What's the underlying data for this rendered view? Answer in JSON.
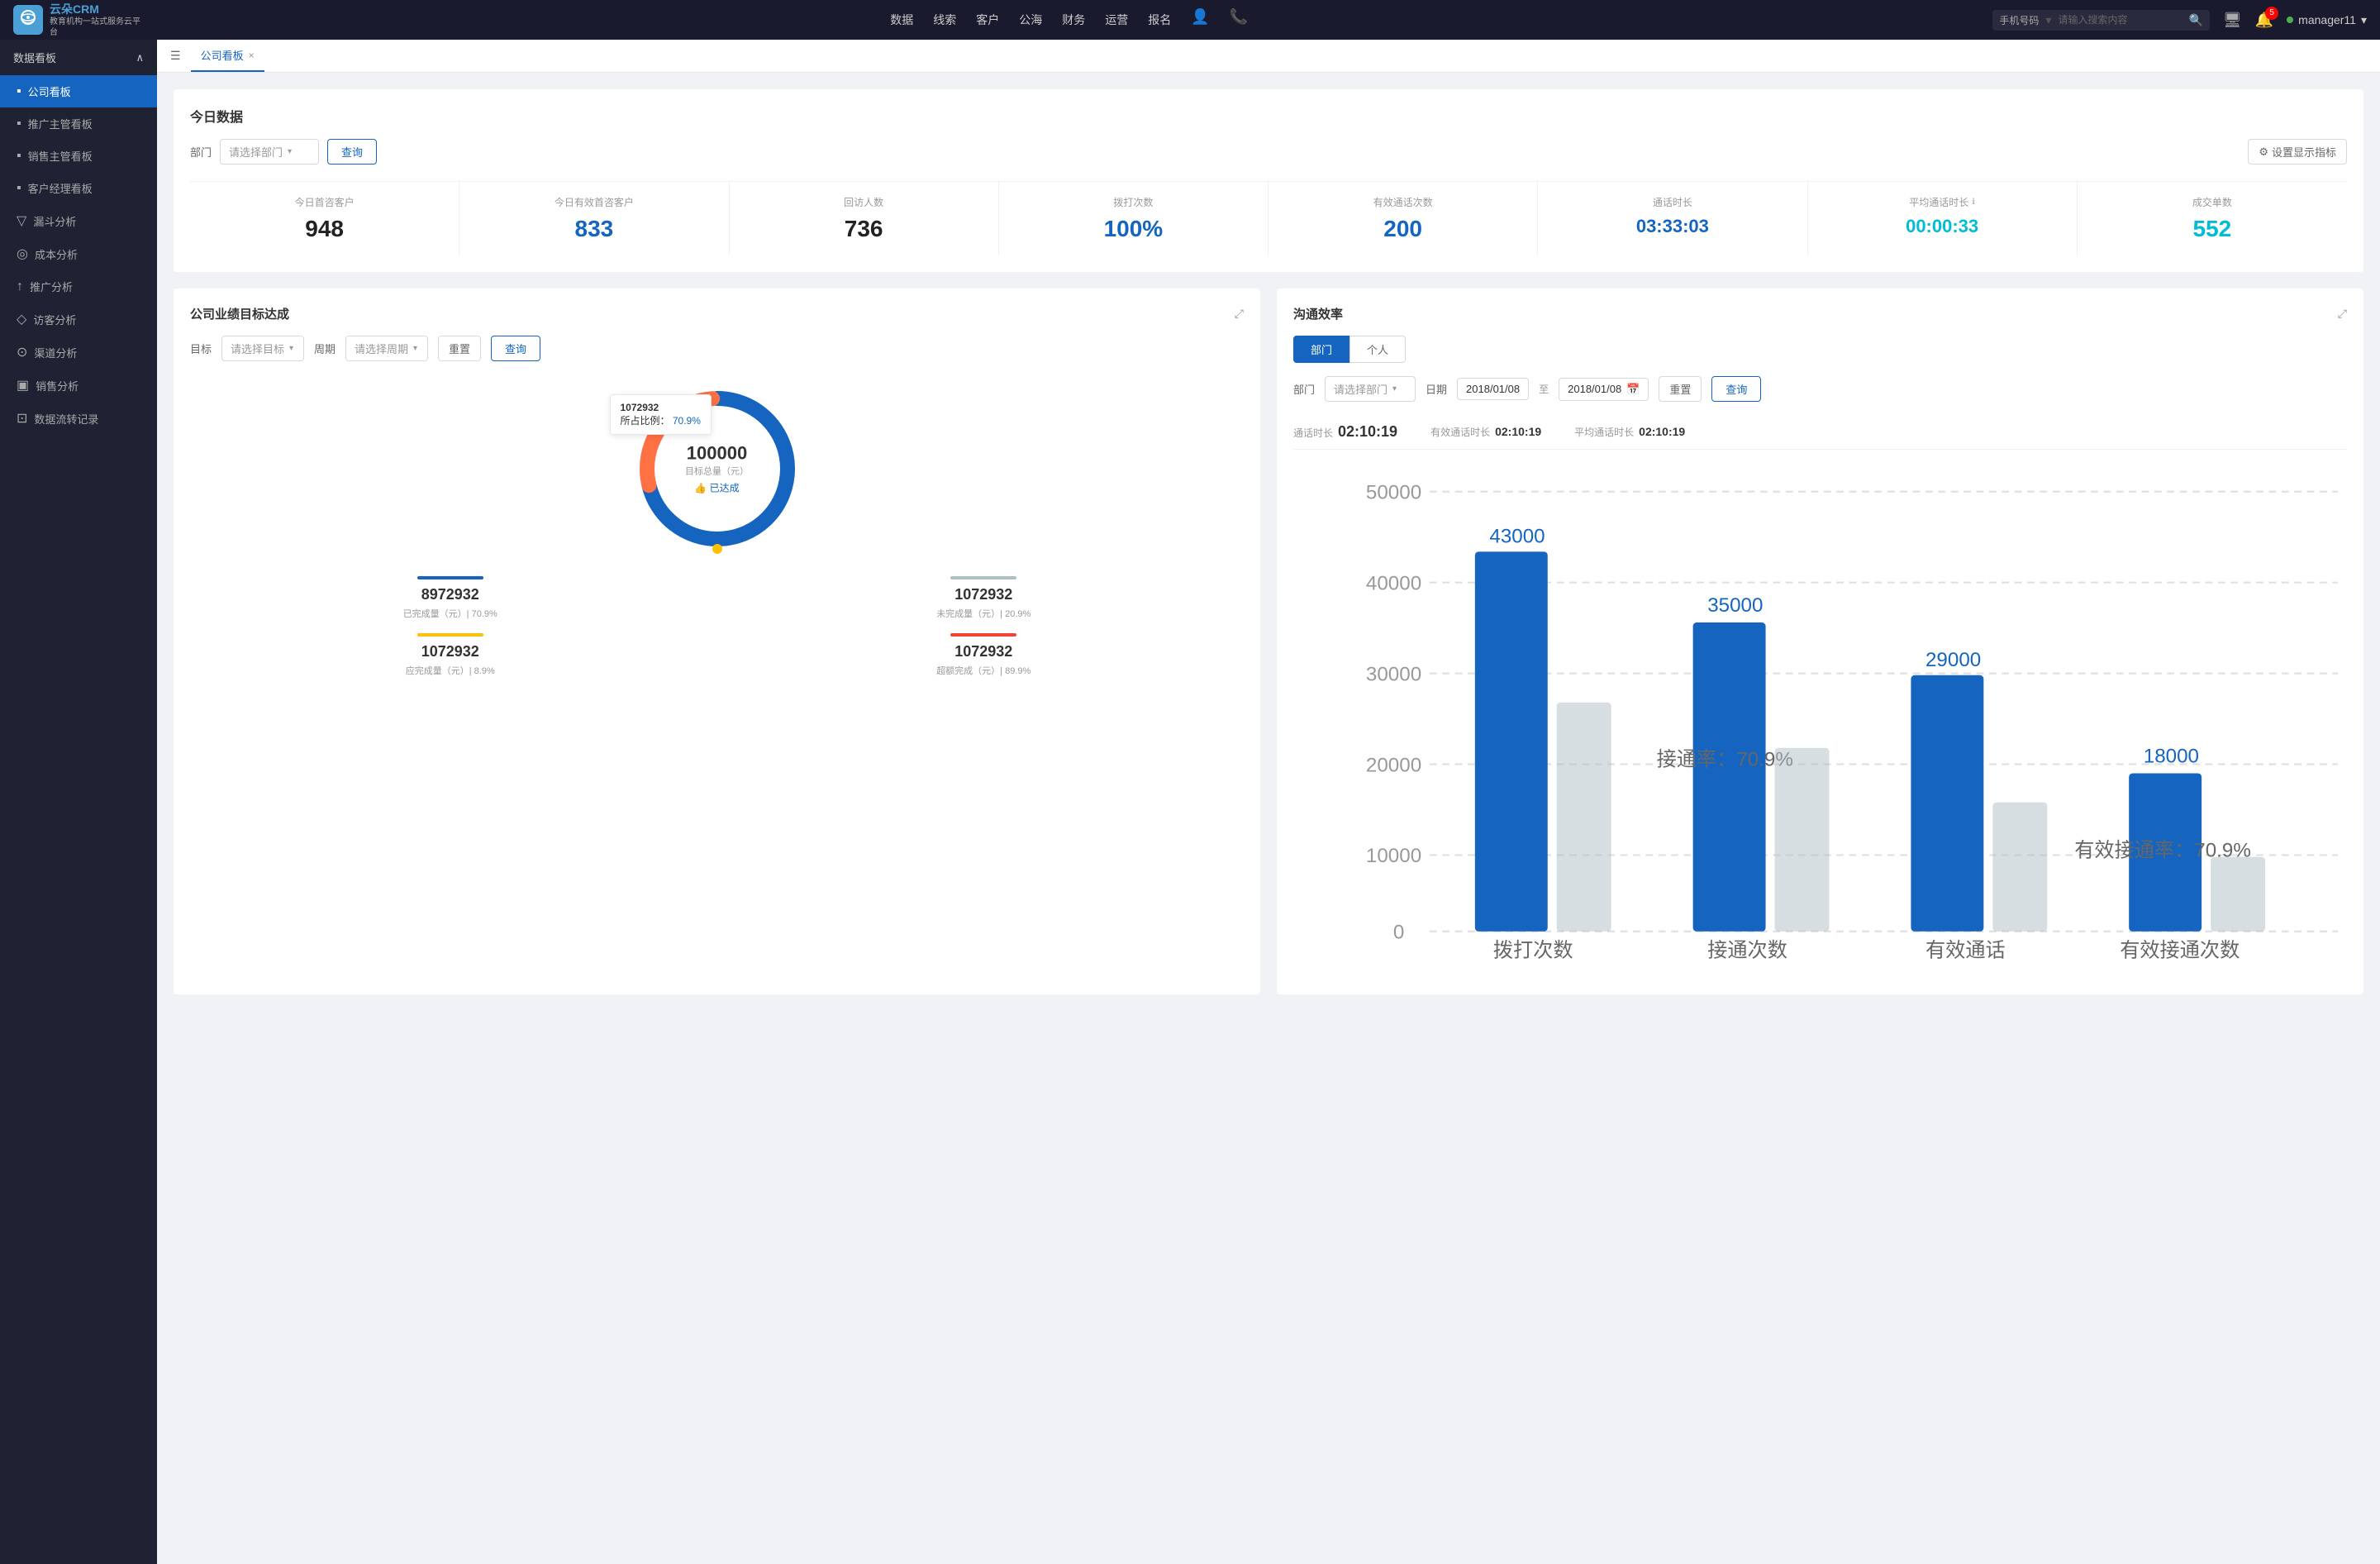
{
  "app": {
    "logo_brand": "云朵CRM",
    "logo_sub": "教育机构一站\n式服务云平台"
  },
  "nav": {
    "items": [
      "数据",
      "线索",
      "客户",
      "公海",
      "财务",
      "运营",
      "报名"
    ],
    "search_placeholder": "请输入搜索内容",
    "search_type": "手机号码",
    "notification_count": "5",
    "username": "manager11"
  },
  "sidebar": {
    "section_label": "数据看板",
    "items": [
      {
        "label": "公司看板",
        "icon": "▪",
        "active": true
      },
      {
        "label": "推广主管看板",
        "icon": "▪",
        "active": false
      },
      {
        "label": "销售主管看板",
        "icon": "▪",
        "active": false
      },
      {
        "label": "客户经理看板",
        "icon": "▪",
        "active": false
      },
      {
        "label": "漏斗分析",
        "icon": "▼",
        "active": false
      },
      {
        "label": "成本分析",
        "icon": "◎",
        "active": false
      },
      {
        "label": "推广分析",
        "icon": "↑",
        "active": false
      },
      {
        "label": "访客分析",
        "icon": "♦",
        "active": false
      },
      {
        "label": "渠道分析",
        "icon": "⊙",
        "active": false
      },
      {
        "label": "销售分析",
        "icon": "▣",
        "active": false
      },
      {
        "label": "数据流转记录",
        "icon": "⊡",
        "active": false
      }
    ]
  },
  "tab": {
    "label": "公司看板",
    "close_icon": "×"
  },
  "today_section": {
    "title": "今日数据",
    "dept_label": "部门",
    "dept_placeholder": "请选择部门",
    "query_btn": "查询",
    "settings_btn": "设置显示指标",
    "metrics": [
      {
        "label": "今日首咨客户",
        "value": "948",
        "color": "dark"
      },
      {
        "label": "今日有效首咨客户",
        "value": "833",
        "color": "blue"
      },
      {
        "label": "回访人数",
        "value": "736",
        "color": "dark"
      },
      {
        "label": "拨打次数",
        "value": "100%",
        "color": "blue"
      },
      {
        "label": "有效通话次数",
        "value": "200",
        "color": "blue"
      },
      {
        "label": "通话时长",
        "value": "03:33:03",
        "color": "blue"
      },
      {
        "label": "平均通话时长",
        "value": "00:00:33",
        "color": "cyan"
      },
      {
        "label": "成交单数",
        "value": "552",
        "color": "cyan"
      }
    ]
  },
  "goal_panel": {
    "title": "公司业绩目标达成",
    "goal_label": "目标",
    "goal_placeholder": "请选择目标",
    "period_label": "周期",
    "period_placeholder": "请选择周期",
    "reset_btn": "重置",
    "query_btn": "查询",
    "donut": {
      "main_num": "100000",
      "sub_label": "目标总量（元）",
      "achieved_label": "👍 已达成",
      "tooltip_value": "1072932",
      "tooltip_percent_label": "所占比例：",
      "tooltip_percent": "70.9%"
    },
    "stats": [
      {
        "value": "8972932",
        "label": "已完成量（元）| 70.9%",
        "bar_color": "#1565c0"
      },
      {
        "value": "1072932",
        "label": "未完成量（元）| 20.9%",
        "bar_color": "#b0bec5"
      },
      {
        "value": "1072932",
        "label": "应完成量（元）| 8.9%",
        "bar_color": "#ffc107"
      },
      {
        "value": "1072932",
        "label": "超额完成（元）| 89.9%",
        "bar_color": "#f44336"
      }
    ]
  },
  "comm_panel": {
    "title": "沟通效率",
    "tabs": [
      "部门",
      "个人"
    ],
    "active_tab": "部门",
    "dept_label": "部门",
    "dept_placeholder": "请选择部门",
    "date_label": "日期",
    "date_start": "2018/01/08",
    "date_to": "至",
    "date_end": "2018/01/08",
    "reset_btn": "重置",
    "query_btn": "查询",
    "stats": [
      {
        "label": "通话时长",
        "value": "02:10:19"
      },
      {
        "label": "有效通话时长",
        "value": "02:10:19"
      },
      {
        "label": "平均通话时长",
        "value": "02:10:19"
      }
    ],
    "chart": {
      "y_labels": [
        "50000",
        "40000",
        "30000",
        "20000",
        "10000",
        "0"
      ],
      "bars": [
        {
          "x_label": "拨打次数",
          "value1": 43000,
          "value1_label": "43000",
          "value2": null,
          "rate": null
        },
        {
          "x_label": "接通次数",
          "value1": 35000,
          "value1_label": "35000",
          "rate": "接通率：70.9%",
          "value2": null
        },
        {
          "x_label": "有效通话",
          "value1": 29000,
          "value1_label": "29000",
          "rate": null,
          "value2": null
        },
        {
          "x_label": "有效接通次数",
          "value1": 18000,
          "value1_label": "18000",
          "rate": "有效接通率：70.9%",
          "value2": null
        }
      ]
    }
  }
}
